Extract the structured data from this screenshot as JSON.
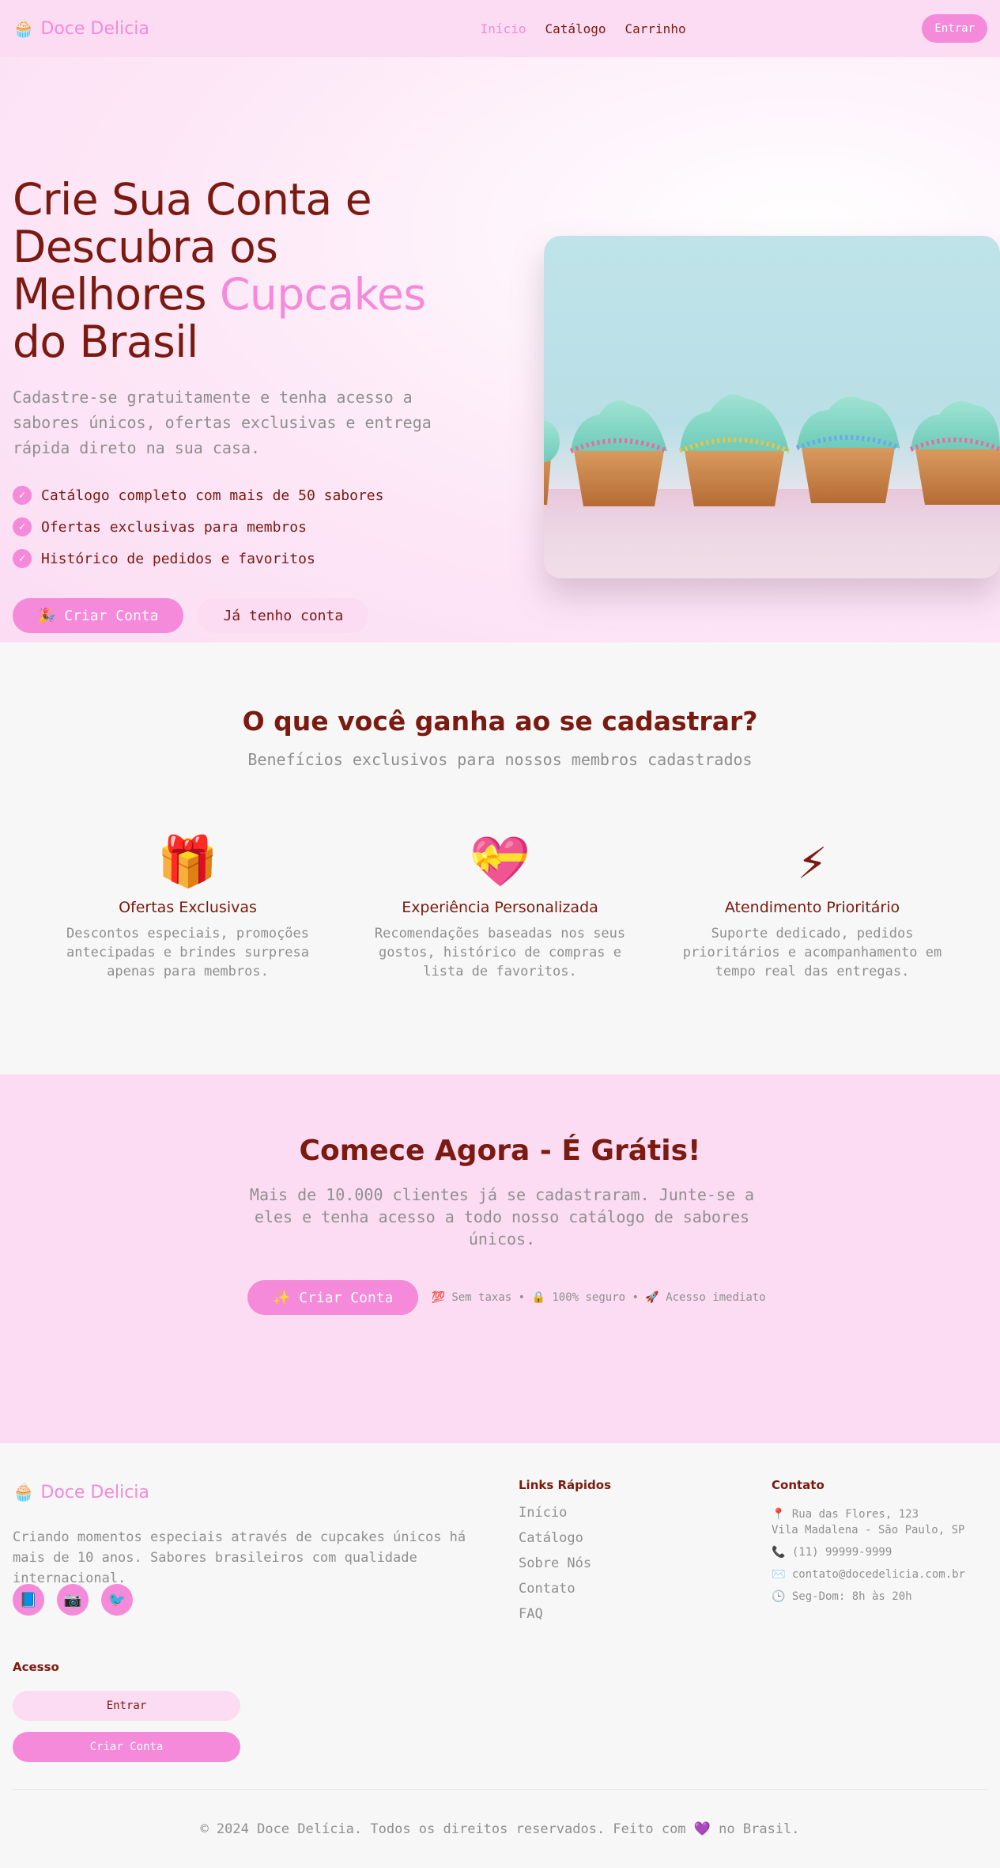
{
  "nav": {
    "logo_icon": "🧁",
    "logo_text": "Doce Delicia",
    "links": [
      "Início",
      "Catálogo",
      "Carrinho"
    ],
    "active_link": "Início",
    "login_button": "Entrar"
  },
  "hero": {
    "title_1": "Crie Sua Conta e",
    "title_2": "Descubra os",
    "title_3a": "Melhores ",
    "title_3b": "Cupcakes",
    "title_4": "do Brasil",
    "subtitle": "Cadastre-se gratuitamente e tenha acesso a sabores únicos, ofertas exclusivas e entrega rápida direto na sua casa.",
    "features": [
      "Catálogo completo com mais de 50 sabores",
      "Ofertas exclusivas para membros",
      "Histórico de pedidos e favoritos"
    ],
    "check_icon": "✓",
    "primary_button": "🎉 Criar Conta",
    "secondary_button": "Já tenho conta",
    "image": "cupcakes-photo"
  },
  "benefits": {
    "title": "O que você ganha ao se cadastrar?",
    "subtitle": "Benefícios exclusivos para nossos membros cadastrados",
    "cards": [
      {
        "icon": "🎁",
        "title": "Ofertas Exclusivas",
        "text": "Descontos especiais, promoções antecipadas e brindes surpresa apenas para membros."
      },
      {
        "icon": "💝",
        "title": "Experiência Personalizada",
        "text": "Recomendações baseadas nos seus gostos, histórico de compras e lista de favoritos."
      },
      {
        "icon": "⚡",
        "title": "Atendimento Prioritário",
        "text": "Suporte dedicado, pedidos prioritários e acompanhamento em tempo real das entregas."
      }
    ]
  },
  "cta": {
    "title": "Comece Agora - É Grátis!",
    "subtitle": "Mais de 10.000 clientes já se cadastraram. Junte-se a eles e tenha acesso a todo nosso catálogo de sabores únicos.",
    "button": "✨ Criar Conta",
    "note": "💯 Sem taxas • 🔒 100% seguro • 🚀 Acesso imediato"
  },
  "footer": {
    "logo_icon": "🧁",
    "logo_text": "Doce Delicia",
    "description": "Criando momentos especiais através de cupcakes únicos há mais de 10 anos. Sabores brasileiros com qualidade internacional.",
    "social": [
      "📘",
      "📷",
      "🐦"
    ],
    "access_heading": "Acesso",
    "access_login": "Entrar",
    "access_signup": "Criar Conta",
    "links_heading": "Links Rápidos",
    "links": [
      "Início",
      "Catálogo",
      "Sobre Nós",
      "Contato",
      "FAQ"
    ],
    "contact_heading": "Contato",
    "contact": {
      "address_1": "📍 Rua das Flores, 123",
      "address_2": "Vila Madalena - São Paulo, SP",
      "phone": "📞 (11) 99999-9999",
      "email": "✉️ contato@docedelicia.com.br",
      "hours": "🕒 Seg-Dom: 8h às 20h"
    },
    "copyright": "© 2024 Doce Delícia. Todos os direitos reservados. Feito com 💜 no Brasil."
  },
  "colors": {
    "pink": "#f48ad9",
    "light_pink": "#fcdcf3",
    "brown": "#7a1a10",
    "gray_text": "#8f8f8f",
    "background": "#f6f7f6"
  }
}
